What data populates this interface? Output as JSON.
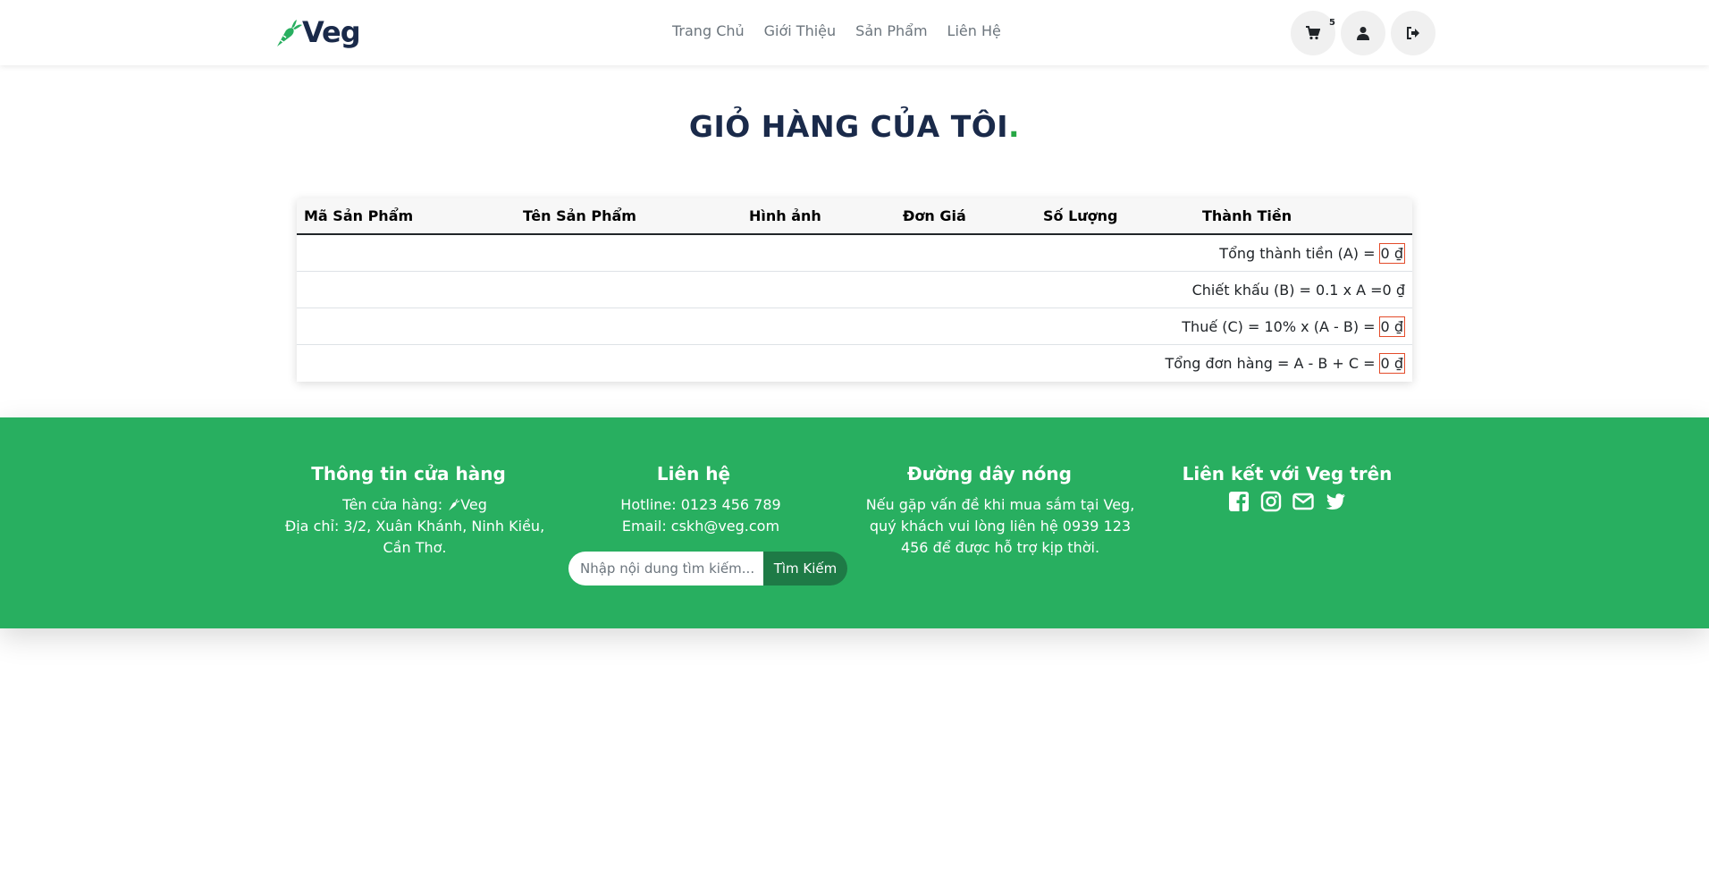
{
  "brand": {
    "name": "Veg",
    "accent": "#28af60",
    "dark": "#1a2a4a"
  },
  "nav": {
    "items": [
      "Trang Chủ",
      "Giới Thiệu",
      "Sản Phẩm",
      "Liên Hệ"
    ]
  },
  "header": {
    "cart_count": "5",
    "icons": [
      "cart-icon",
      "user-icon",
      "logout-icon"
    ]
  },
  "page": {
    "title": "GIỎ HÀNG CỦA TÔI",
    "title_dot": "."
  },
  "table": {
    "columns": [
      "Mã Sản Phẩm",
      "Tên Sản Phẩm",
      "Hình ảnh",
      "Đơn Giá",
      "Số Lượng",
      "Thành Tiền"
    ],
    "summary": {
      "subtotal_label": "Tổng thành tiền (A) =",
      "subtotal_value": "0 ₫",
      "discount_label": "Chiết khấu (B) = 0.1 x A =0 ₫",
      "tax_label": "Thuế (C) = 10% x (A - B) =",
      "tax_value": "0 ₫",
      "total_label": "Tổng đơn hàng = A - B + C =",
      "total_value": "0 ₫"
    }
  },
  "footer": {
    "store": {
      "heading": "Thông tin cửa hàng",
      "name_label": "Tên cửa hàng:",
      "name_value": "Veg",
      "address": "Địa chỉ: 3/2, Xuân Khánh, Ninh Kiều, Cần Thơ."
    },
    "contact": {
      "heading": "Liên hệ",
      "hotline": "Hotline: 0123 456 789",
      "email": "Email: cskh@veg.com"
    },
    "search": {
      "placeholder": "Nhập nội dung tìm kiếm...",
      "button": "Tìm Kiếm"
    },
    "hotline": {
      "heading": "Đường dây nóng",
      "text": "Nếu gặp vấn đề khi mua sắm tại Veg, quý khách vui lòng liên hệ 0939 123 456 để được hỗ trợ kịp thời."
    },
    "social": {
      "heading": "Liên kết với Veg trên",
      "icons": [
        "facebook-icon",
        "instagram-icon",
        "envelope-icon",
        "twitter-icon"
      ]
    }
  }
}
